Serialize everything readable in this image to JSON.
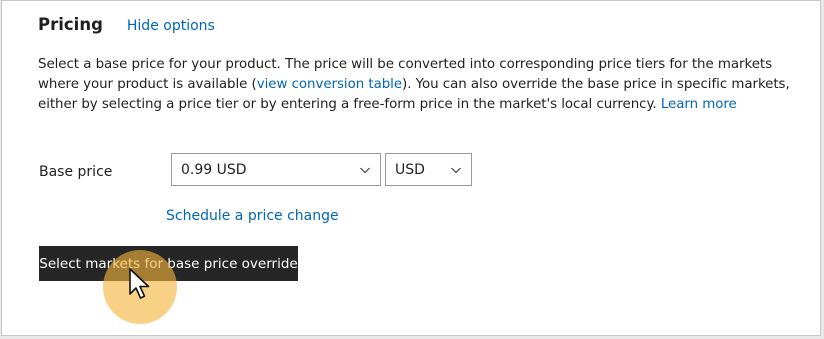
{
  "pricing": {
    "title": "Pricing",
    "hide_options_label": "Hide options",
    "description": {
      "part1": "Select a base price for your product. The price will be converted into corresponding price tiers for the markets where your product is available (",
      "conversion_link": "view conversion table",
      "part2": "). You can also override the base price in specific markets, either by selecting a price tier or by entering a free-form price in the market's local currency. ",
      "learn_more_link": "Learn more"
    },
    "base_price": {
      "label": "Base price",
      "price_value": "0.99 USD",
      "currency_value": "USD"
    },
    "schedule_link": "Schedule a price change",
    "override_button_label": "Select markets for base price override"
  },
  "colors": {
    "link": "#0067b8",
    "button_background": "#262626",
    "click_highlight": "#f5b43c"
  },
  "icons": {
    "dropdown": "chevron-down-icon",
    "pointer": "hand-pointer-cursor-icon"
  }
}
